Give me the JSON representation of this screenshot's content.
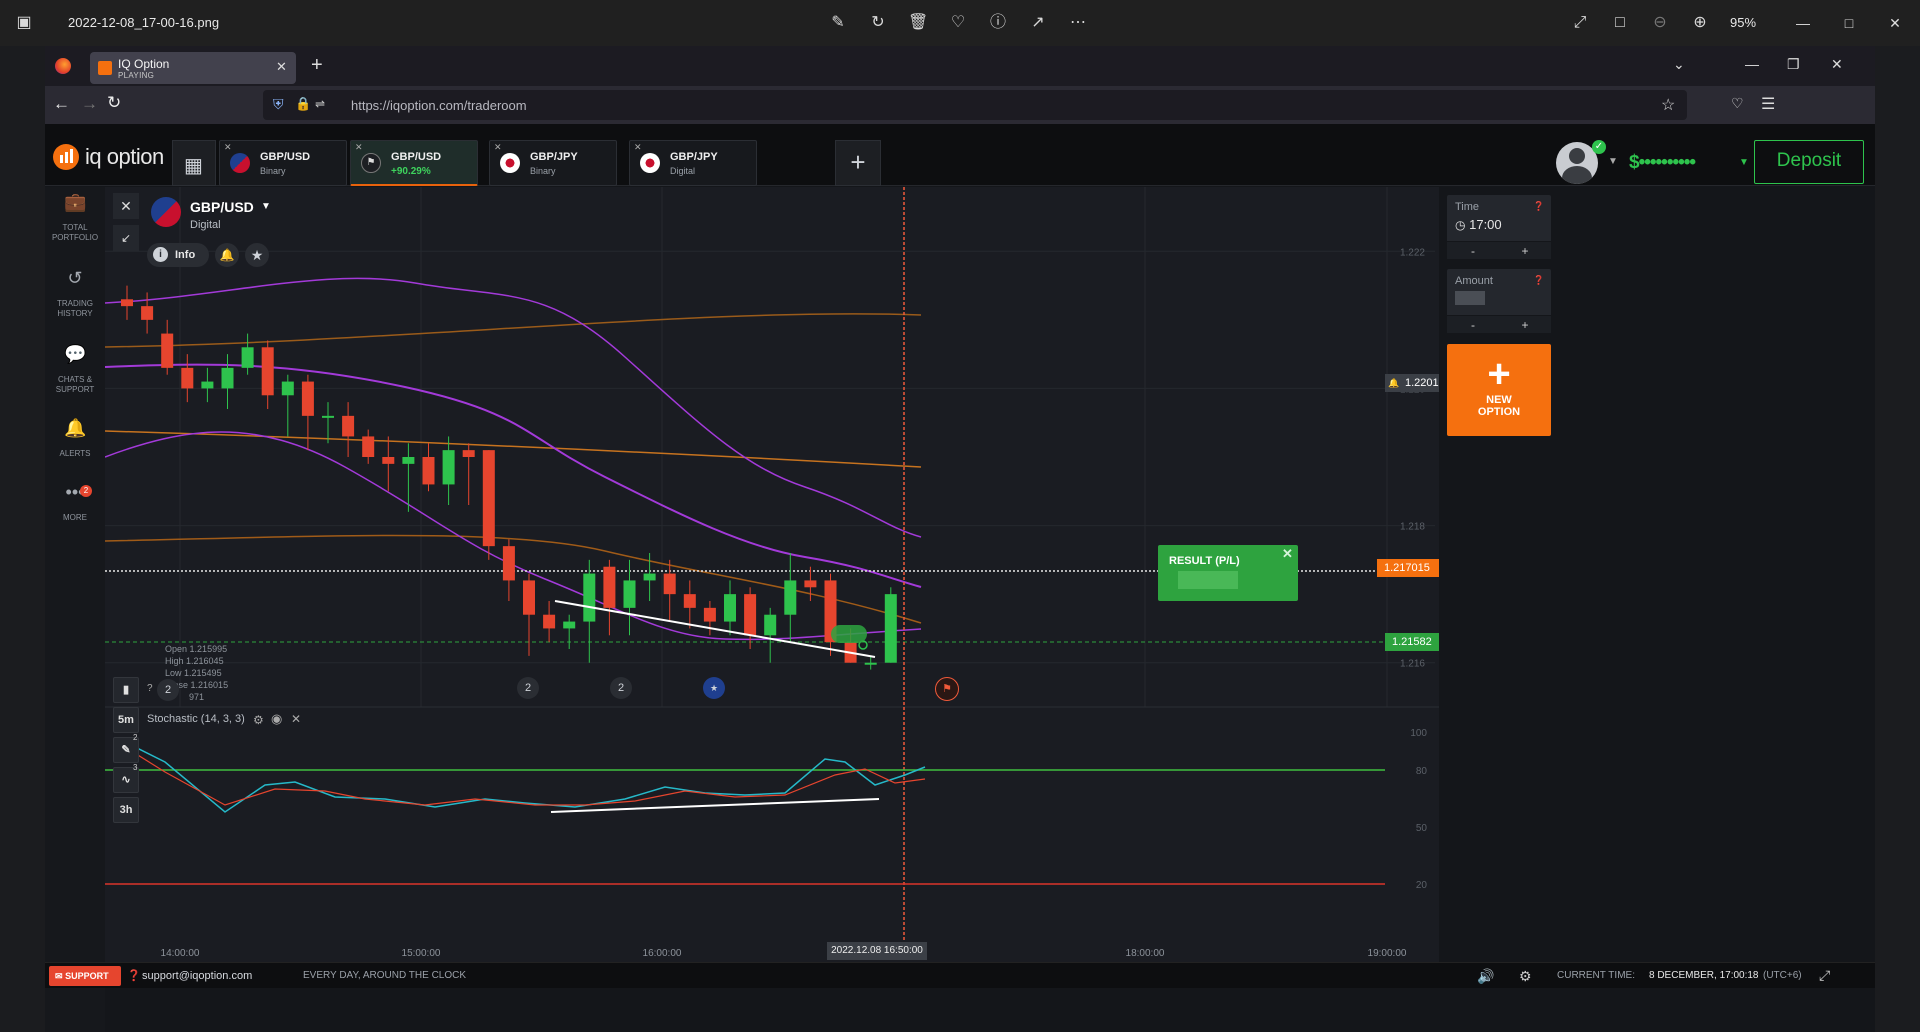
{
  "viewer": {
    "filename": "2022-12-08_17-00-16.png",
    "zoom": "95%"
  },
  "browser": {
    "tab_title": "IQ Option",
    "tab_status": "PLAYING",
    "url": "https://iqoption.com/traderoom"
  },
  "app": {
    "brand": "iq option",
    "asset_tabs": [
      {
        "name": "GBP/USD",
        "sub": "Binary",
        "active": false
      },
      {
        "name": "GBP/USD",
        "sub": "+90.29%",
        "active": true
      },
      {
        "name": "GBP/JPY",
        "sub": "Binary",
        "active": false
      },
      {
        "name": "GBP/JPY",
        "sub": "Digital",
        "active": false
      }
    ],
    "balance_masked": "$••••••••••",
    "deposit_label": "Deposit"
  },
  "sidebar": {
    "items": [
      {
        "label": "TOTAL PORTFOLIO",
        "icon": "briefcase-icon"
      },
      {
        "label": "TRADING HISTORY",
        "icon": "history-icon"
      },
      {
        "label": "CHATS & SUPPORT",
        "icon": "chat-icon"
      },
      {
        "label": "ALERTS",
        "icon": "bell-icon"
      },
      {
        "label": "MORE",
        "icon": "more-icon",
        "badge": "2"
      }
    ]
  },
  "chart_header": {
    "asset": "GBP/USD",
    "type": "Digital",
    "info_label": "Info"
  },
  "ohlc": {
    "open_label": "Open",
    "open": "1.215995",
    "high_label": "High",
    "high": "1.216045",
    "low_label": "Low",
    "low": "1.215495",
    "close_label": "Close",
    "close": "1.216015",
    "volume": "971"
  },
  "price_axis": [
    "1.222",
    "1.220",
    "1.218",
    "1.216"
  ],
  "price_tags": {
    "alert": "1.22015",
    "current": "1.217015",
    "strike": "1.21582"
  },
  "time_axis": [
    "14:00:00",
    "15:00:00",
    "16:00:00",
    "18:00:00",
    "19:00:00"
  ],
  "cursor_time": "2022.12.08 16:50:00",
  "result_box": {
    "label": "RESULT (P/L)"
  },
  "event_chips": [
    "2",
    "2",
    "2"
  ],
  "indicator": {
    "name": "Stochastic (14, 3, 3)",
    "levels": [
      "100",
      "80",
      "50",
      "20"
    ]
  },
  "timeframes": [
    "5m",
    "3h"
  ],
  "tool_badges": [
    "2",
    "3"
  ],
  "right_panel": {
    "time_label": "Time",
    "time_value": "17:00",
    "amount_label": "Amount",
    "minus": "-",
    "plus": "+",
    "new_option_line1": "NEW",
    "new_option_line2": "OPTION"
  },
  "footer": {
    "support_label": "SUPPORT",
    "email": "support@iqoption.com",
    "hours": "EVERY DAY, AROUND THE CLOCK",
    "current_time_label": "CURRENT TIME:",
    "current_time": "8 DECEMBER, 17:00:18",
    "timezone": "(UTC+6)"
  },
  "colors": {
    "accent": "#f5700f",
    "green": "#2ec34d",
    "red": "#e6452e",
    "purple": "#a33ad9",
    "orange_line": "#c7731f"
  },
  "chart_data": {
    "type": "candlestick",
    "ylim": [
      1.2155,
      1.2225
    ],
    "candles": [
      {
        "o": 1.2213,
        "h": 1.2215,
        "l": 1.221,
        "c": 1.2212
      },
      {
        "o": 1.2212,
        "h": 1.2214,
        "l": 1.2208,
        "c": 1.221
      },
      {
        "o": 1.2208,
        "h": 1.221,
        "l": 1.2202,
        "c": 1.2203
      },
      {
        "o": 1.2203,
        "h": 1.2205,
        "l": 1.2198,
        "c": 1.22
      },
      {
        "o": 1.22,
        "h": 1.2203,
        "l": 1.2198,
        "c": 1.2201
      },
      {
        "o": 1.22,
        "h": 1.2205,
        "l": 1.2197,
        "c": 1.2203
      },
      {
        "o": 1.2203,
        "h": 1.2208,
        "l": 1.2202,
        "c": 1.2206
      },
      {
        "o": 1.2206,
        "h": 1.2207,
        "l": 1.2197,
        "c": 1.2199
      },
      {
        "o": 1.2199,
        "h": 1.2202,
        "l": 1.2193,
        "c": 1.2201
      },
      {
        "o": 1.2201,
        "h": 1.2202,
        "l": 1.2191,
        "c": 1.2196
      },
      {
        "o": 1.2196,
        "h": 1.2198,
        "l": 1.2192,
        "c": 1.2196
      },
      {
        "o": 1.2196,
        "h": 1.2198,
        "l": 1.219,
        "c": 1.2193
      },
      {
        "o": 1.2193,
        "h": 1.2194,
        "l": 1.2189,
        "c": 1.219
      },
      {
        "o": 1.219,
        "h": 1.2193,
        "l": 1.2185,
        "c": 1.2189
      },
      {
        "o": 1.2189,
        "h": 1.2192,
        "l": 1.2182,
        "c": 1.219
      },
      {
        "o": 1.219,
        "h": 1.2192,
        "l": 1.2185,
        "c": 1.2186
      },
      {
        "o": 1.2186,
        "h": 1.2193,
        "l": 1.2183,
        "c": 1.2191
      },
      {
        "o": 1.2191,
        "h": 1.2192,
        "l": 1.2183,
        "c": 1.219
      },
      {
        "o": 1.2191,
        "h": 1.2191,
        "l": 1.2175,
        "c": 1.2177
      },
      {
        "o": 1.2177,
        "h": 1.2178,
        "l": 1.2169,
        "c": 1.2172
      },
      {
        "o": 1.2172,
        "h": 1.2173,
        "l": 1.2161,
        "c": 1.2167
      },
      {
        "o": 1.2167,
        "h": 1.2169,
        "l": 1.2163,
        "c": 1.2165
      },
      {
        "o": 1.2165,
        "h": 1.2167,
        "l": 1.2162,
        "c": 1.2166
      },
      {
        "o": 1.2166,
        "h": 1.2175,
        "l": 1.216,
        "c": 1.2173
      },
      {
        "o": 1.2174,
        "h": 1.2175,
        "l": 1.2164,
        "c": 1.2168
      },
      {
        "o": 1.2168,
        "h": 1.2175,
        "l": 1.2164,
        "c": 1.2172
      },
      {
        "o": 1.2172,
        "h": 1.2176,
        "l": 1.2169,
        "c": 1.2173
      },
      {
        "o": 1.2173,
        "h": 1.2175,
        "l": 1.2166,
        "c": 1.217
      },
      {
        "o": 1.217,
        "h": 1.2172,
        "l": 1.2165,
        "c": 1.2168
      },
      {
        "o": 1.2168,
        "h": 1.2169,
        "l": 1.2164,
        "c": 1.2166
      },
      {
        "o": 1.2166,
        "h": 1.2172,
        "l": 1.2164,
        "c": 1.217
      },
      {
        "o": 1.217,
        "h": 1.2171,
        "l": 1.2162,
        "c": 1.2164
      },
      {
        "o": 1.2164,
        "h": 1.2168,
        "l": 1.216,
        "c": 1.2167
      },
      {
        "o": 1.2167,
        "h": 1.2176,
        "l": 1.2163,
        "c": 1.2172
      },
      {
        "o": 1.2172,
        "h": 1.2174,
        "l": 1.2169,
        "c": 1.2171
      },
      {
        "o": 1.2172,
        "h": 1.2173,
        "l": 1.2161,
        "c": 1.2163
      },
      {
        "o": 1.2163,
        "h": 1.2165,
        "l": 1.216,
        "c": 1.216
      },
      {
        "o": 1.216,
        "h": 1.2161,
        "l": 1.2159,
        "c": 1.216
      },
      {
        "o": 1.216,
        "h": 1.2171,
        "l": 1.216,
        "c": 1.217
      }
    ]
  }
}
